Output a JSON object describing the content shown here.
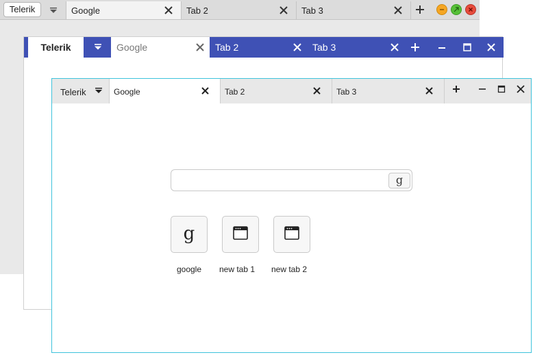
{
  "windows": [
    {
      "theme": "mac",
      "brand": "Telerik",
      "tabs": [
        {
          "label": "Google",
          "selected": true
        },
        {
          "label": "Tab 2",
          "selected": false
        },
        {
          "label": "Tab 3",
          "selected": false
        }
      ],
      "window_buttons": {
        "minimize_color": "#f5a623",
        "maximize_color": "#57c038",
        "close_color": "#e74c3c"
      }
    },
    {
      "theme": "material",
      "brand": "Telerik",
      "accent": "#3f51b5",
      "tabs": [
        {
          "label": "Google",
          "selected": true
        },
        {
          "label": "Tab 2",
          "selected": false
        },
        {
          "label": "Tab 3",
          "selected": false
        }
      ]
    },
    {
      "theme": "flat",
      "brand": "Telerik",
      "border_color": "#3ec3dc",
      "tabs": [
        {
          "label": "Google",
          "selected": true
        },
        {
          "label": "Tab 2",
          "selected": false
        },
        {
          "label": "Tab 3",
          "selected": false
        }
      ]
    }
  ],
  "content": {
    "search": {
      "value": "",
      "placeholder": "",
      "button_glyph": "g"
    },
    "shortcuts": [
      {
        "label": "google",
        "icon": "google-g-icon",
        "glyph": "g"
      },
      {
        "label": "new tab 1",
        "icon": "browser-window-icon"
      },
      {
        "label": "new tab 2",
        "icon": "browser-window-icon"
      }
    ]
  }
}
